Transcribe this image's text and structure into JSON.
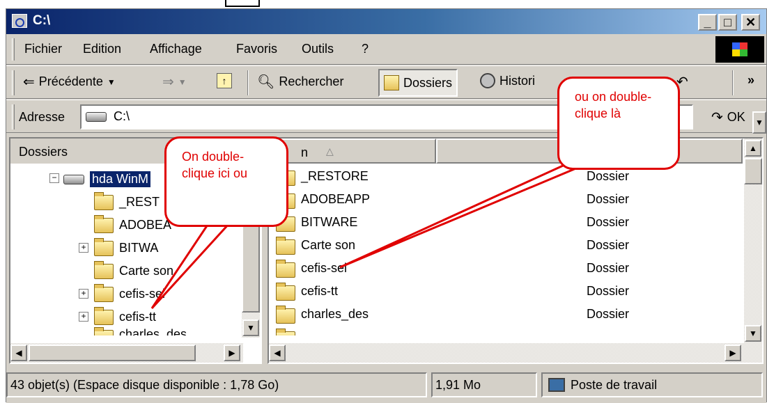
{
  "window": {
    "title": "C:\\"
  },
  "menubar": {
    "items": [
      {
        "label": "Fichier"
      },
      {
        "label": "Edition"
      },
      {
        "label": "Affichage"
      },
      {
        "label": "Favoris"
      },
      {
        "label": "Outils"
      },
      {
        "label": "?"
      }
    ]
  },
  "toolbar": {
    "back": "Précédente",
    "search": "Rechercher",
    "folders": "Dossiers",
    "history": "Histori"
  },
  "address": {
    "label": "Adresse",
    "value": "C:\\",
    "go": "OK"
  },
  "tree": {
    "header": "Dossiers",
    "close": "×",
    "items": [
      {
        "label": "hda WinM"
      },
      {
        "label": "_REST"
      },
      {
        "label": "ADOBEA"
      },
      {
        "label": "BITWA"
      },
      {
        "label": "Carte son"
      },
      {
        "label": "cefis-sel"
      },
      {
        "label": "cefis-tt"
      },
      {
        "label": "charles_des"
      }
    ]
  },
  "list": {
    "col_name": "n",
    "col_sort_glyph": "△",
    "rows": [
      {
        "name": "_RESTORE",
        "type": "Dossier"
      },
      {
        "name": "ADOBEAPP",
        "type": "Dossier"
      },
      {
        "name": "BITWARE",
        "type": "Dossier"
      },
      {
        "name": "Carte son",
        "type": "Dossier"
      },
      {
        "name": "cefis-sel",
        "type": "Dossier"
      },
      {
        "name": "cefis-tt",
        "type": "Dossier"
      },
      {
        "name": "charles_des",
        "type": "Dossier"
      }
    ]
  },
  "statusbar": {
    "objects": "43 objet(s) (Espace disque disponible : 1,78 Go)",
    "size": "1,91 Mo",
    "zone": "Poste de travail"
  },
  "callouts": {
    "left": "On double-clique ici ou",
    "right": "ou on double-clique là"
  },
  "colors": {
    "title_start": "#0a246a",
    "title_end": "#a6caf0",
    "face": "#d4d0c8",
    "callout": "#e00000",
    "selection": "#0a246a"
  }
}
